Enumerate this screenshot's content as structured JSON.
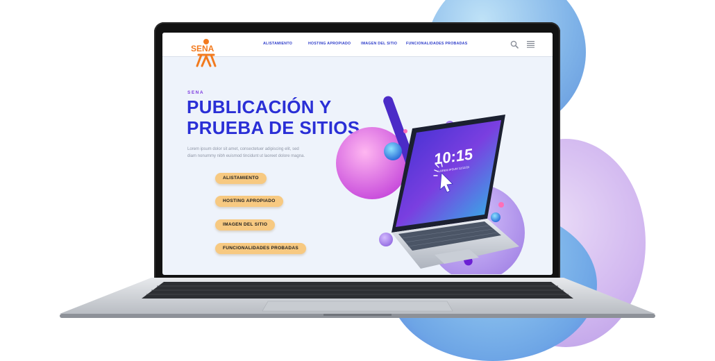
{
  "site": {
    "logo_text": "SENA",
    "nav": [
      "ALISTAMIENTO",
      "HOSTING APROPIADO",
      "IMAGEN DEL SITIO",
      "FUNCIONALIDADES PROBADAS"
    ],
    "kicker": "SENA",
    "title_line1": "PUBLICACIÓN Y",
    "title_line2": "PRUEBA DE SITIOS",
    "body_line1": "Lorem ipsum dolor sit amet, consectetuer adipiscing elit, sed",
    "body_line2": "diam nonummy nibh euismod tincidunt ut laoreet dolore magna.",
    "buttons": [
      "ALISTAMIENTO",
      "HOSTING APROPIADO",
      "IMAGEN DEL SITIO",
      "FUNCIONALIDADES PROBADAS"
    ],
    "clock": "10:15",
    "clock_caption": "LOREM IPSUM 12/12/20"
  },
  "icons": {
    "search": "search-icon",
    "menu": "hamburger-menu-icon"
  },
  "colors": {
    "brand_orange": "#f27a1e",
    "title_blue": "#2a2fd6",
    "nav_blue": "#2b3ac9",
    "kicker_purple": "#7d3be0",
    "pill_orange": "#f7c981",
    "screen_bg": "#eef3fb"
  }
}
